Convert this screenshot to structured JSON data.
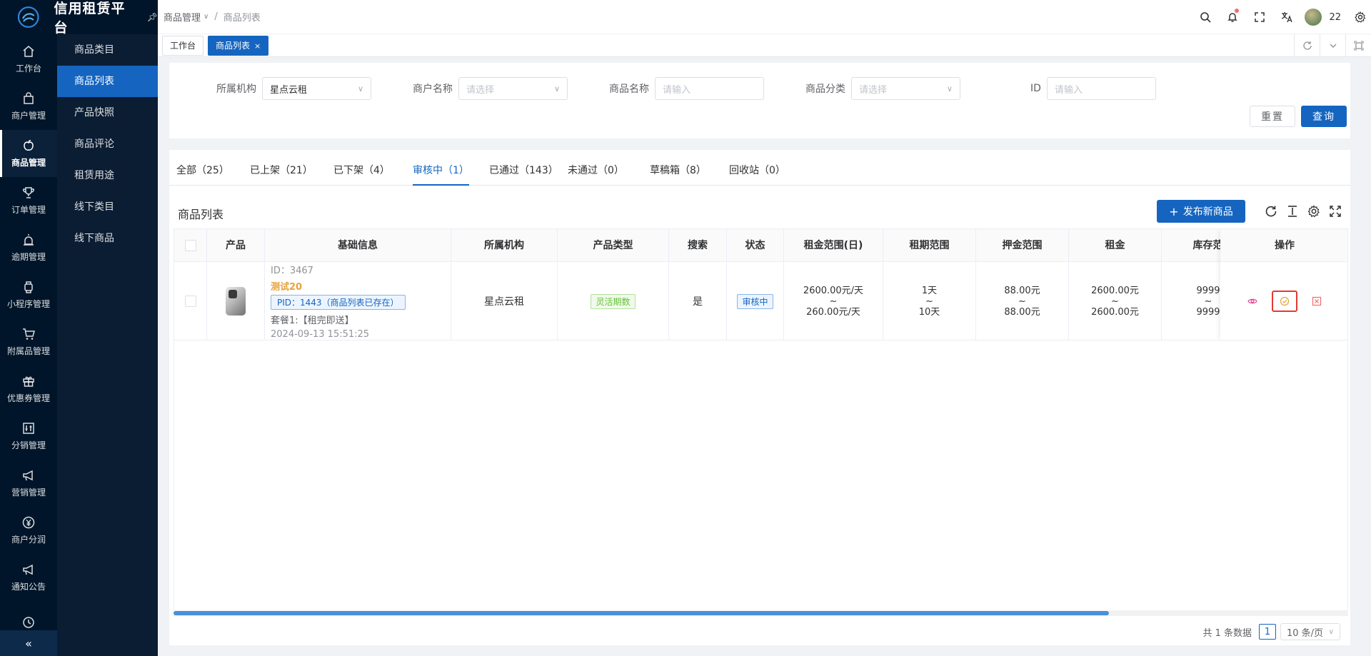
{
  "app": {
    "title": "信用租赁平台"
  },
  "rail": [
    {
      "label": "工作台",
      "icon": "home-icon"
    },
    {
      "label": "商户管理",
      "icon": "bag-icon"
    },
    {
      "label": "商品管理",
      "icon": "apple-icon",
      "active": true
    },
    {
      "label": "订单管理",
      "icon": "trophy-icon"
    },
    {
      "label": "逾期管理",
      "icon": "alarm-icon"
    },
    {
      "label": "小程序管理",
      "icon": "watch-icon"
    },
    {
      "label": "附属品管理",
      "icon": "cart-icon"
    },
    {
      "label": "优惠券管理",
      "icon": "gift-icon"
    },
    {
      "label": "分销管理",
      "icon": "adjust-icon"
    },
    {
      "label": "营销管理",
      "icon": "megaphone-icon"
    },
    {
      "label": "商户分润",
      "icon": "yen-icon"
    },
    {
      "label": "通知公告",
      "icon": "megaphone-icon"
    },
    {
      "label": "",
      "icon": "clock-icon"
    }
  ],
  "submenu": [
    {
      "label": "商品类目"
    },
    {
      "label": "商品列表",
      "active": true
    },
    {
      "label": "产品快照"
    },
    {
      "label": "商品评论"
    },
    {
      "label": "租赁用途"
    },
    {
      "label": "线下类目"
    },
    {
      "label": "线下商品"
    }
  ],
  "breadcrumb": {
    "parent": "商品管理",
    "current": "商品列表"
  },
  "header": {
    "username": "22"
  },
  "pagetabs": [
    {
      "label": "工作台"
    },
    {
      "label": "商品列表",
      "active": true,
      "close": "×"
    }
  ],
  "filter": {
    "org_label": "所属机构",
    "org_value": "星点云租",
    "merchant_label": "商户名称",
    "merchant_placeholder": "请选择",
    "goods_label": "商品名称",
    "goods_placeholder": "请输入",
    "category_label": "商品分类",
    "category_placeholder": "请选择",
    "id_label": "ID",
    "id_placeholder": "请输入",
    "reset": "重置",
    "query": "查询"
  },
  "status_tabs": [
    {
      "label": "全部（25）"
    },
    {
      "label": "已上架（21）"
    },
    {
      "label": "已下架（4）"
    },
    {
      "label": "审核中（1）",
      "active": true
    },
    {
      "label": "已通过（143）"
    },
    {
      "label": "未通过（0）"
    },
    {
      "label": "草稿箱（8）"
    },
    {
      "label": "回收站（0）"
    }
  ],
  "list": {
    "title": "商品列表",
    "publish": "发布新商品"
  },
  "table": {
    "columns": [
      "产品",
      "基础信息",
      "所属机构",
      "产品类型",
      "搜索",
      "状态",
      "租金范围(日)",
      "租期范围",
      "押金范围",
      "租金",
      "库存范",
      "操作"
    ],
    "row": {
      "id": "ID：3467",
      "name": "测试20",
      "pid": "PID：1443（商品列表已存在）",
      "package": "套餐1:【租完即送】",
      "time": "2024-09-13 15:51:25",
      "org": "星点云租",
      "type": "灵活期数",
      "search": "是",
      "status": "审核中",
      "rent_range": [
        "2600.00元/天",
        "~",
        "260.00元/天"
      ],
      "term_range": [
        "1天",
        "~",
        "10天"
      ],
      "deposit_range": [
        "88.00元",
        "~",
        "88.00元"
      ],
      "rent": [
        "2600.00元",
        "~",
        "2600.00元"
      ],
      "stock": [
        "9999",
        "~",
        "9999"
      ]
    }
  },
  "pager": {
    "total": "共 1 条数据",
    "page": "1",
    "size": "10 条/页"
  }
}
